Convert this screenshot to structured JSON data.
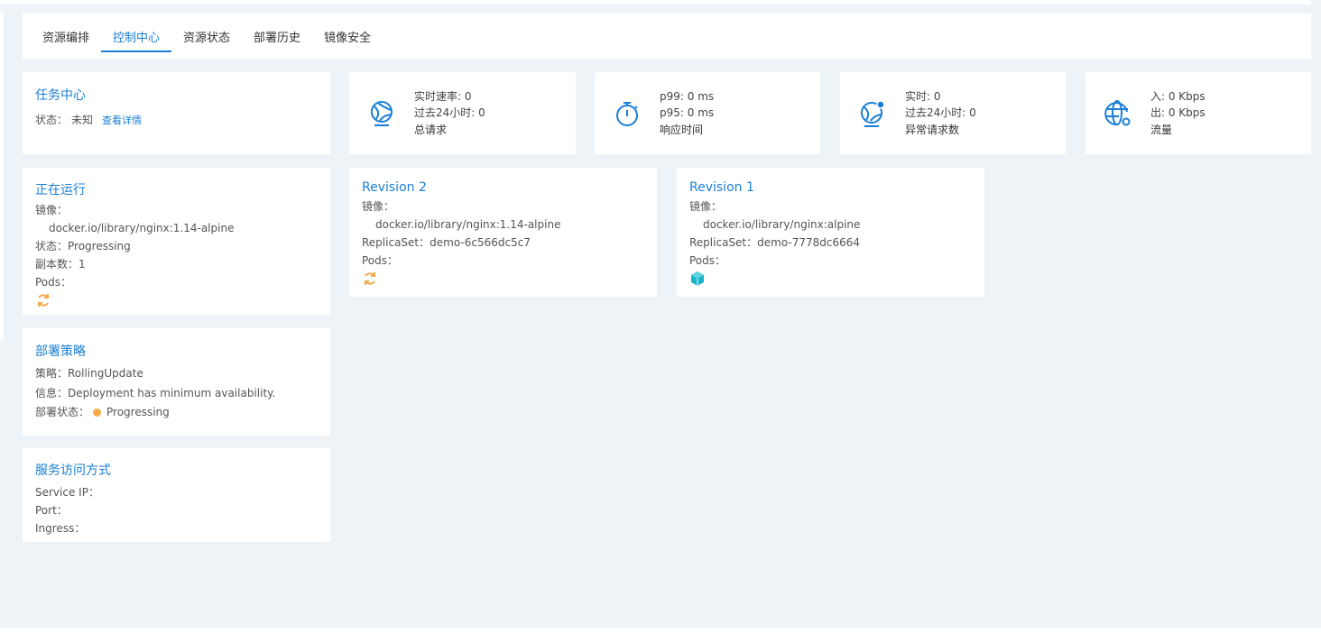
{
  "tabs": [
    {
      "label": "资源编排",
      "active": false
    },
    {
      "label": "控制中心",
      "active": true
    },
    {
      "label": "资源状态",
      "active": false
    },
    {
      "label": "部署历史",
      "active": false
    },
    {
      "label": "镜像安全",
      "active": false
    }
  ],
  "task_center": {
    "title": "任务中心",
    "status_label": "状态：",
    "status_value": "未知",
    "details_link": "查看详情"
  },
  "stats": {
    "total_requests": {
      "line1": "实时速率: 0",
      "line2": "过去24小时: 0",
      "label": "总请求",
      "icon": "globe-icon"
    },
    "response_time": {
      "line1": "p99: 0 ms",
      "line2": "p95: 0 ms",
      "label": "响应时间",
      "icon": "stopwatch-icon"
    },
    "error_requests": {
      "line1": "实时: 0",
      "line2": "过去24小时: 0",
      "label": "异常请求数",
      "icon": "globe-alert-icon"
    },
    "traffic": {
      "line1": "入: 0 Kbps",
      "line2": "出: 0 Kbps",
      "label": "流量",
      "icon": "network-globe-icon"
    }
  },
  "running": {
    "title": "正在运行",
    "image_label": "镜像：",
    "image_value": "docker.io/library/nginx:1.14-alpine",
    "status": "状态：Progressing",
    "replicas": "副本数：1",
    "pods_label": "Pods："
  },
  "revision2": {
    "title": "Revision 2",
    "image_label": "镜像：",
    "image_value": "docker.io/library/nginx:1.14-alpine",
    "replicaset": "ReplicaSet：demo-6c566dc5c7",
    "pods_label": "Pods："
  },
  "revision1": {
    "title": "Revision 1",
    "image_label": "镜像：",
    "image_value": "docker.io/library/nginx:alpine",
    "replicaset": "ReplicaSet：demo-7778dc6664",
    "pods_label": "Pods："
  },
  "strategy": {
    "title": "部署策略",
    "strategy": "策略：RollingUpdate",
    "info": "信息：Deployment has minimum availability.",
    "deploy_status_label": "部署状态：",
    "deploy_status_value": "Progressing"
  },
  "service_access": {
    "title": "服务访问方式",
    "service_ip": "Service IP：",
    "port": "Port：",
    "ingress": "Ingress："
  },
  "colors": {
    "accent": "#1a7fd4",
    "progress": "#f5a94a",
    "pod_ready": "#19b4c8",
    "background": "#edf3f7"
  }
}
